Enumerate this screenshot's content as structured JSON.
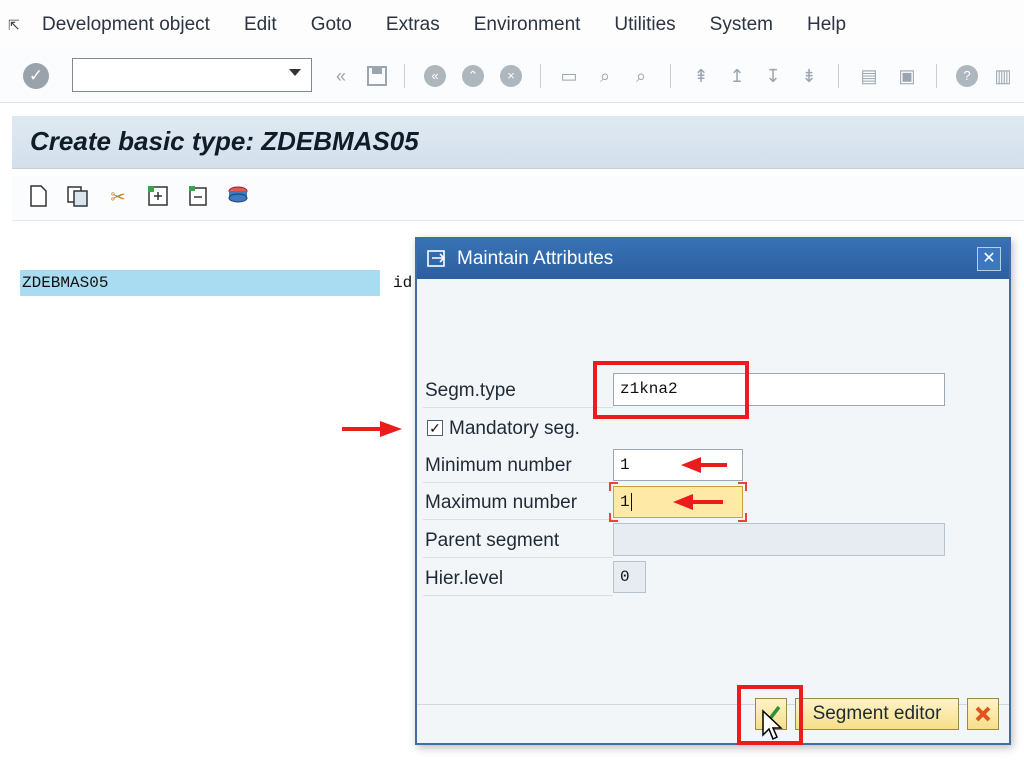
{
  "menu": {
    "items": [
      "Development object",
      "Edit",
      "Goto",
      "Extras",
      "Environment",
      "Utilities",
      "System",
      "Help"
    ]
  },
  "toolbar": {
    "command_field_value": ""
  },
  "page": {
    "title": "Create basic type: ZDEBMAS05"
  },
  "tree": {
    "root_label": "ZDEBMAS05",
    "trailing_text": "id"
  },
  "dialog": {
    "title": "Maintain Attributes",
    "fields": {
      "segm_type_label": "Segm.type",
      "segm_type_value": "z1kna2",
      "mandatory_label": "Mandatory seg.",
      "mandatory_checked": true,
      "mandatory_mark": "✓",
      "min_label": "Minimum number",
      "min_value": "1",
      "max_label": "Maximum number",
      "max_value": "1",
      "parent_label": "Parent segment",
      "parent_value": "",
      "hier_label": "Hier.level",
      "hier_value": "0"
    },
    "buttons": {
      "segment_editor_label": "Segment editor"
    }
  },
  "colors": {
    "dialog_title_bg": "#2c5f9e",
    "highlight_red": "#ea1c1c",
    "selected_row": "#a9dcf0",
    "active_field": "#ffe9a6"
  }
}
